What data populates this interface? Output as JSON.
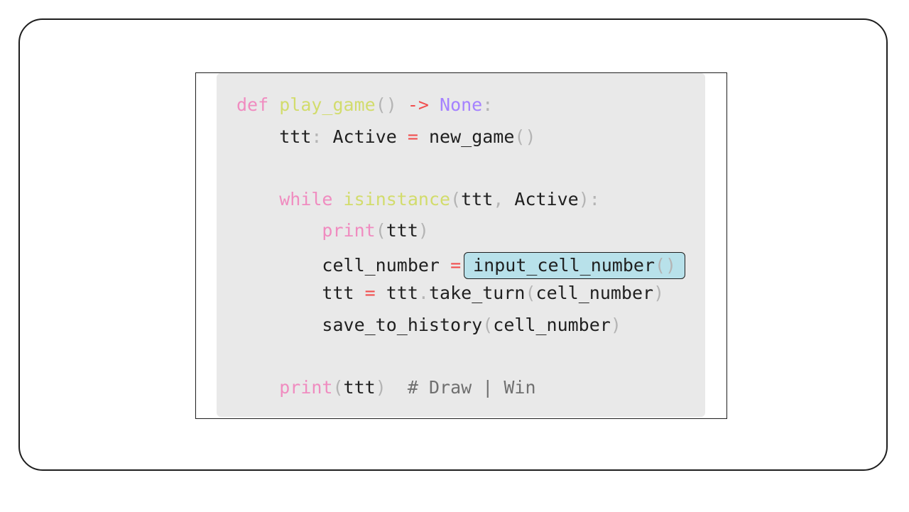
{
  "code": {
    "line1": {
      "def": "def",
      "name": "play_game",
      "parens": "()",
      "arrow": "->",
      "ret": "None",
      "colon": ":"
    },
    "line2": {
      "var": "ttt",
      "colon": ":",
      "type": "Active",
      "eq": "=",
      "call": "new_game",
      "parens": "()"
    },
    "line3": {
      "kw": "while",
      "fn": "isinstance",
      "lparen": "(",
      "arg1": "ttt",
      "comma": ",",
      "arg2": "Active",
      "rparen": ")",
      "colon": ":"
    },
    "line4": {
      "kw": "print",
      "lparen": "(",
      "arg": "ttt",
      "rparen": ")"
    },
    "line5": {
      "var": "cell_number",
      "eq": "=",
      "call": "input_cell_number",
      "parens": "()"
    },
    "line6": {
      "var": "ttt",
      "eq": "=",
      "obj": "ttt",
      "dot": ".",
      "method": "take_turn",
      "lparen": "(",
      "arg": "cell_number",
      "rparen": ")"
    },
    "line7": {
      "call": "save_to_history",
      "lparen": "(",
      "arg": "cell_number",
      "rparen": ")"
    },
    "line8": {
      "kw": "print",
      "lparen": "(",
      "arg": "ttt",
      "rparen": ")",
      "comment": "# Draw | Win"
    }
  }
}
